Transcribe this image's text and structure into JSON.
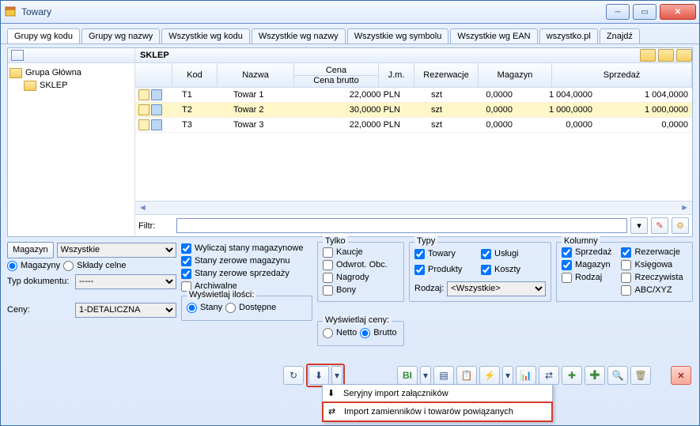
{
  "window": {
    "title": "Towary"
  },
  "tabs": [
    "Grupy wg kodu",
    "Grupy wg nazwy",
    "Wszystkie wg kodu",
    "Wszystkie wg nazwy",
    "Wszystkie wg symbolu",
    "Wszystkie wg EAN",
    "wszystko.pl",
    "Znajdź"
  ],
  "tree": {
    "root": "Grupa Główna",
    "child": "SKLEP"
  },
  "grid": {
    "title": "SKLEP",
    "headers": {
      "kod": "Kod",
      "nazwa": "Nazwa",
      "cena_top": "Cena",
      "cena_sub": "Cena brutto",
      "jm": "J.m.",
      "rez": "Rezerwacje",
      "mag": "Magazyn",
      "spr": "Sprzedaż"
    },
    "rows": [
      {
        "kod": "T1",
        "nazwa": "Towar 1",
        "cena": "22,0000 PLN",
        "jm": "szt",
        "rez": "0,0000",
        "mag": "1 004,0000",
        "spr": "1 004,0000"
      },
      {
        "kod": "T2",
        "nazwa": "Towar 2",
        "cena": "30,0000 PLN",
        "jm": "szt",
        "rez": "0,0000",
        "mag": "1 000,0000",
        "spr": "1 000,0000"
      },
      {
        "kod": "T3",
        "nazwa": "Towar 3",
        "cena": "22,0000 PLN",
        "jm": "szt",
        "rez": "0,0000",
        "mag": "0,0000",
        "spr": "0,0000"
      }
    ]
  },
  "filter": {
    "label": "Filtr:",
    "value": ""
  },
  "left": {
    "magazyn_btn": "Magazyn",
    "magazyn_val": "Wszystkie",
    "magazyny": "Magazyny",
    "sklady": "Składy celne",
    "typdok_lbl": "Typ dokumentu:",
    "typdok_val": "-----",
    "ceny_lbl": "Ceny:",
    "ceny_val": "1-DETALICZNA"
  },
  "mid": {
    "wyliczaj": "Wyliczaj stany magazynowe",
    "zerowe_mag": "Stany zerowe magazynu",
    "zerowe_spr": "Stany zerowe sprzedaży",
    "archiwalne": "Archiwalne",
    "wysw_ilosci": "Wyświetlaj ilości:",
    "stany": "Stany",
    "dostepne": "Dostępne"
  },
  "tylko": {
    "title": "Tylko",
    "kaucje": "Kaucje",
    "odwrot": "Odwrot. Obc.",
    "nagrody": "Nagrody",
    "bony": "Bony"
  },
  "typy": {
    "title": "Typy",
    "towary": "Towary",
    "uslugi": "Usługi",
    "produkty": "Produkty",
    "koszty": "Koszty",
    "rodzaj_lbl": "Rodzaj:",
    "rodzaj_val": "<Wszystkie>"
  },
  "wysw_ceny": {
    "title": "Wyświetlaj ceny:",
    "netto": "Netto",
    "brutto": "Brutto"
  },
  "kolumny": {
    "title": "Kolumny",
    "sprzedaz": "Sprzedaż",
    "magazyn": "Magazyn",
    "rodzaj": "Rodzaj",
    "rezerwacje": "Rezerwacje",
    "ksiegowa": "Księgowa",
    "rzeczywista": "Rzeczywista",
    "abcxyz": "ABC/XYZ"
  },
  "popup": {
    "item1": "Seryjny import załączników",
    "item2": "Import zamienników i towarów powiązanych"
  }
}
